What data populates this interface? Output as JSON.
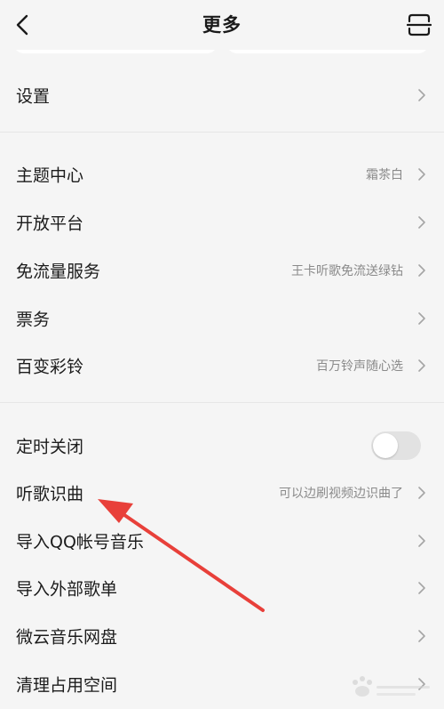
{
  "header": {
    "title": "更多",
    "back_icon": "chevron-left-icon",
    "scan_icon": "scan-icon"
  },
  "settings": {
    "label": "设置"
  },
  "group1": [
    {
      "label": "主题中心",
      "value": "霜茶白"
    },
    {
      "label": "开放平台",
      "value": ""
    },
    {
      "label": "免流量服务",
      "value": "王卡听歌免流送绿钻"
    },
    {
      "label": "票务",
      "value": ""
    },
    {
      "label": "百变彩铃",
      "value": "百万铃声随心选"
    }
  ],
  "group2": [
    {
      "label": "定时关闭",
      "toggle": false
    },
    {
      "label": "听歌识曲",
      "value": "可以边刷视频边识曲了"
    },
    {
      "label": "导入QQ帐号音乐",
      "value": ""
    },
    {
      "label": "导入外部歌单",
      "value": ""
    },
    {
      "label": "微云音乐网盘",
      "value": ""
    },
    {
      "label": "清理占用空间",
      "value": ""
    }
  ],
  "colors": {
    "background": "#f5f5f5",
    "text": "#1c1c1c",
    "secondary": "#8a8a8a",
    "annotation_arrow": "#e8403a"
  }
}
